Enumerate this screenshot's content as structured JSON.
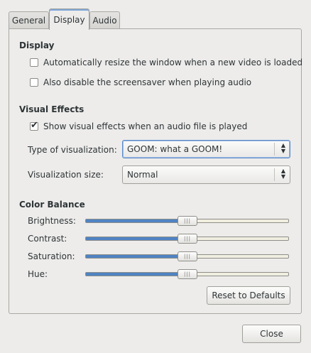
{
  "tabs": [
    {
      "label": "General",
      "active": false
    },
    {
      "label": "Display",
      "active": true
    },
    {
      "label": "Audio",
      "active": false
    }
  ],
  "display_section": {
    "title": "Display",
    "resize_checkbox": {
      "label": "Automatically resize the window when a new video is loaded",
      "checked": false
    },
    "screensaver_checkbox": {
      "label": "Also disable the screensaver when playing audio",
      "checked": false
    }
  },
  "visual_effects": {
    "title": "Visual Effects",
    "show_checkbox": {
      "label": "Show visual effects when an audio file is played",
      "checked": true
    },
    "type_label": "Type of visualization:",
    "type_value": "GOOM: what a GOOM!",
    "size_label": "Visualization size:",
    "size_value": "Normal"
  },
  "color_balance": {
    "title": "Color Balance",
    "sliders": [
      {
        "label": "Brightness:",
        "value": 0.5
      },
      {
        "label": "Contrast:",
        "value": 0.5
      },
      {
        "label": "Saturation:",
        "value": 0.5
      },
      {
        "label": "Hue:",
        "value": 0.5
      }
    ],
    "reset_label": "Reset to Defaults"
  },
  "close_label": "Close",
  "colors": {
    "accent": "#4f83c3",
    "background": "#edeceb"
  },
  "icons": {
    "check": "checkmark-icon",
    "combo": "updown-arrows-icon",
    "slider_grip": "grip-icon"
  }
}
